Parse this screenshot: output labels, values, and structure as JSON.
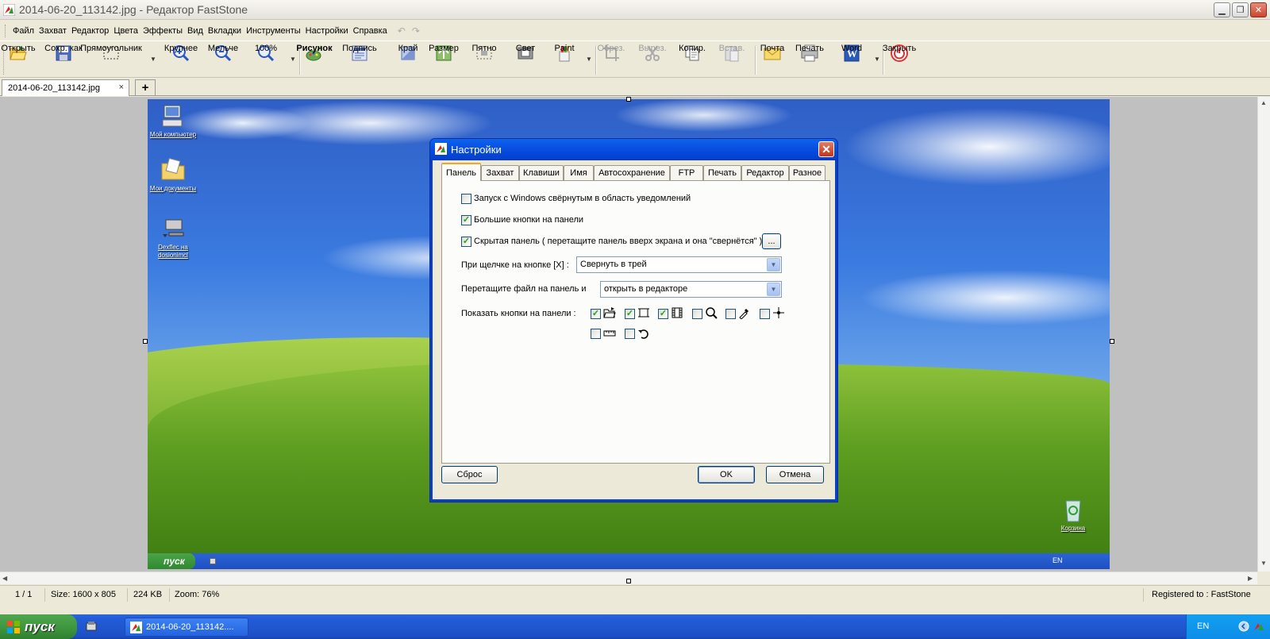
{
  "window": {
    "title": "2014-06-20_113142.jpg - Редактор FastStone",
    "minimize_icon": "minimize-icon",
    "restore_icon": "restore-icon",
    "close_icon": "close-icon"
  },
  "menu": [
    "Файл",
    "Захват",
    "Редактор",
    "Цвета",
    "Эффекты",
    "Вид",
    "Вкладки",
    "Инструменты",
    "Настройки",
    "Справка"
  ],
  "toolbar": {
    "open": "Открыть",
    "save_as": "Сохр. как",
    "rectangle": "Прямоугольник",
    "zoom_in": "Крупнее",
    "zoom_out": "Мельче",
    "zoom_level": "100%",
    "draw": "Рисунок",
    "caption": "Подпись",
    "edge": "Край",
    "resize": "Размер",
    "spot": "Пятно",
    "light": "Свет",
    "paint": "Paint",
    "crop": "Обрез.",
    "cut": "Вырез.",
    "copy": "Копир.",
    "paste": "Встав.",
    "email": "Почта",
    "print": "Печать",
    "word": "Word",
    "close": "Закрыть"
  },
  "tabs": {
    "doc_tab": "2014-06-20_113142.jpg",
    "close": "×",
    "add": "+"
  },
  "desktop": {
    "icons": [
      "Мой компьютер",
      "Мои документы",
      "Dexflec на dosionimcl"
    ],
    "recycle": "Корзина",
    "start": "пуск",
    "lang": "EN"
  },
  "dialog": {
    "title": "Настройки",
    "tabs": [
      "Панель",
      "Захват",
      "Клавиши",
      "Имя",
      "Автосохранение",
      "FTP",
      "Печать",
      "Редактор",
      "Разное"
    ],
    "active_tab": "Панель",
    "opt_start_tray": {
      "label": "Запуск с Windows свёрнутым в область уведомлений",
      "checked": false
    },
    "opt_big_buttons": {
      "label": "Большие кнопки на панели",
      "checked": true
    },
    "opt_hidden_panel": {
      "label": "Скрытая панель ( перетащите панель вверх экрана и она \"свернётся\" )",
      "checked": true
    },
    "more_button": "...",
    "click_x_label": "При щелчке на кнопке [X] :",
    "click_x_value": "Свернуть в трей",
    "drag_file_label": "Перетащите файл на панель и",
    "drag_file_value": "открыть в редакторе",
    "show_buttons_label": "Показать кнопки на панели :",
    "panel_buttons": [
      {
        "icon": "open-folder-icon",
        "checked": true
      },
      {
        "icon": "rectangle-capture-icon",
        "checked": true
      },
      {
        "icon": "film-capture-icon",
        "checked": true
      },
      {
        "icon": "magnifier-icon",
        "checked": false
      },
      {
        "icon": "eyedropper-icon",
        "checked": false
      },
      {
        "icon": "crosshair-icon",
        "checked": false
      },
      {
        "icon": "ruler-icon",
        "checked": false
      },
      {
        "icon": "undo-icon",
        "checked": false
      }
    ],
    "check_mark": "✓",
    "reset": "Сброс",
    "ok": "OK",
    "cancel": "Отмена"
  },
  "status": {
    "page": "1 / 1",
    "size": "Size: 1600 x 805",
    "filesize": "224 KB",
    "zoom": "Zoom: 76%",
    "registered": "Registered to : FastStone"
  },
  "taskbar": {
    "start": "пуск",
    "task": "2014-06-20_113142....",
    "lang": "EN"
  }
}
